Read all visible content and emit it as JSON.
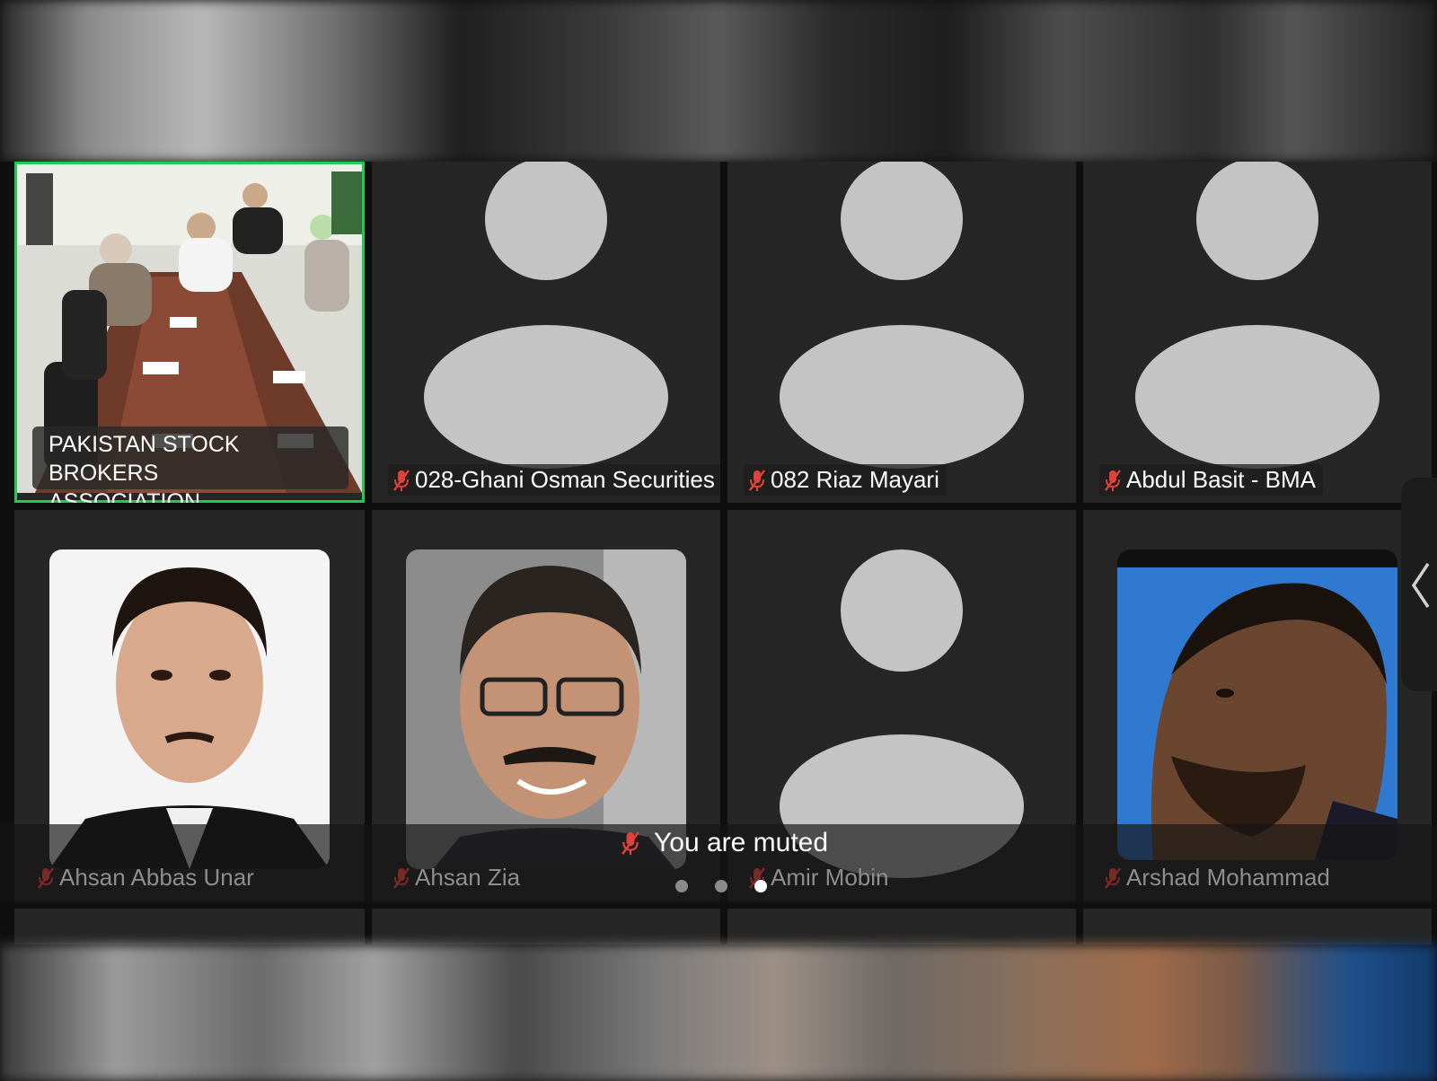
{
  "participants": [
    {
      "name": "PAKISTAN STOCK BROKERS ASSOCIATION",
      "line1": "PAKISTAN STOCK BROKERS",
      "line2": "ASSOCIATION",
      "video": "meeting-room",
      "active_speaker": true
    },
    {
      "name": "028-Ghani Osman Securities",
      "muted": true,
      "video": "avatar-placeholder"
    },
    {
      "name": "082 Riaz Mayari",
      "muted": true,
      "video": "avatar-placeholder"
    },
    {
      "name": "Abdul Basit - BMA",
      "muted": true,
      "video": "avatar-placeholder"
    },
    {
      "name": "Ahsan Abbas Unar",
      "muted": true,
      "video": "profile-photo"
    },
    {
      "name": "Ahsan Zia",
      "muted": true,
      "video": "profile-photo"
    },
    {
      "name": "Amir Mobin",
      "muted": true,
      "video": "avatar-placeholder"
    },
    {
      "name": "Arshad Mohammad",
      "muted": true,
      "video": "profile-photo"
    }
  ],
  "toast": {
    "text": "You are muted",
    "icon": "mic-off-icon"
  },
  "pagination": {
    "pages": 3,
    "current": 3
  },
  "colors": {
    "active_border": "#20c95a",
    "mic_off": "#e0413a",
    "tile_bg": "#262626",
    "placeholder": "#c4c4c4"
  },
  "side_handle": {
    "icon": "chevron-left-icon"
  }
}
